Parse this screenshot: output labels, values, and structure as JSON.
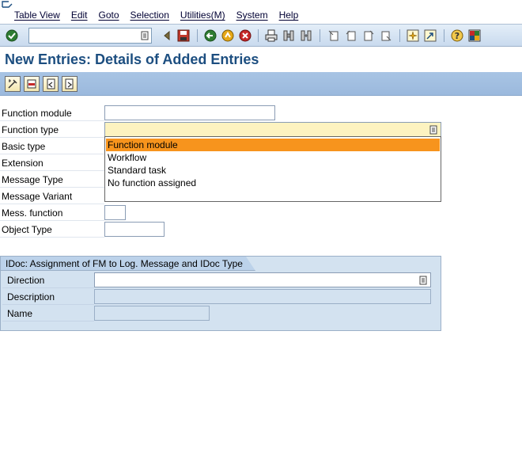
{
  "menu": {
    "items": [
      "Table View",
      "Edit",
      "Goto",
      "Selection",
      "Utilities(M)",
      "System",
      "Help"
    ]
  },
  "toolbar": {
    "command_field_value": "",
    "icons": [
      "enter-icon",
      "back-triangle-icon",
      "save-icon",
      "back-icon",
      "exit-icon",
      "cancel-icon",
      "print-icon",
      "find-icon",
      "find-next-icon",
      "first-page-icon",
      "prev-page-icon",
      "next-page-icon",
      "last-page-icon",
      "create-session-icon",
      "shortcut-icon",
      "help-icon",
      "layout-icon"
    ]
  },
  "title": "New Entries: Details of Added Entries",
  "app_toolbar": {
    "icons": [
      "change-icon",
      "delete-icon",
      "previous-entry-icon",
      "next-entry-icon"
    ]
  },
  "form": {
    "fields": [
      {
        "label": "Function module",
        "value": ""
      },
      {
        "label": "Function type",
        "value": ""
      },
      {
        "label": "Basic type",
        "value": ""
      },
      {
        "label": "Extension",
        "value": ""
      },
      {
        "label": "Message Type",
        "value": ""
      },
      {
        "label": "Message Variant",
        "value": ""
      },
      {
        "label": "Mess. function",
        "value": ""
      },
      {
        "label": "Object Type",
        "value": ""
      }
    ]
  },
  "dropdown": {
    "options": [
      "Function module",
      "Workflow",
      "Standard task",
      "No function assigned"
    ],
    "selected_index": 0
  },
  "group": {
    "title": "IDoc: Assignment of FM to Log. Message and IDoc Type",
    "fields": [
      {
        "label": "Direction",
        "value": ""
      },
      {
        "label": "Description",
        "value": ""
      },
      {
        "label": "Name",
        "value": ""
      }
    ]
  },
  "colors": {
    "title": "#1c4e80",
    "selected_option": "#f7941d",
    "required_field": "#fdf3c0"
  }
}
